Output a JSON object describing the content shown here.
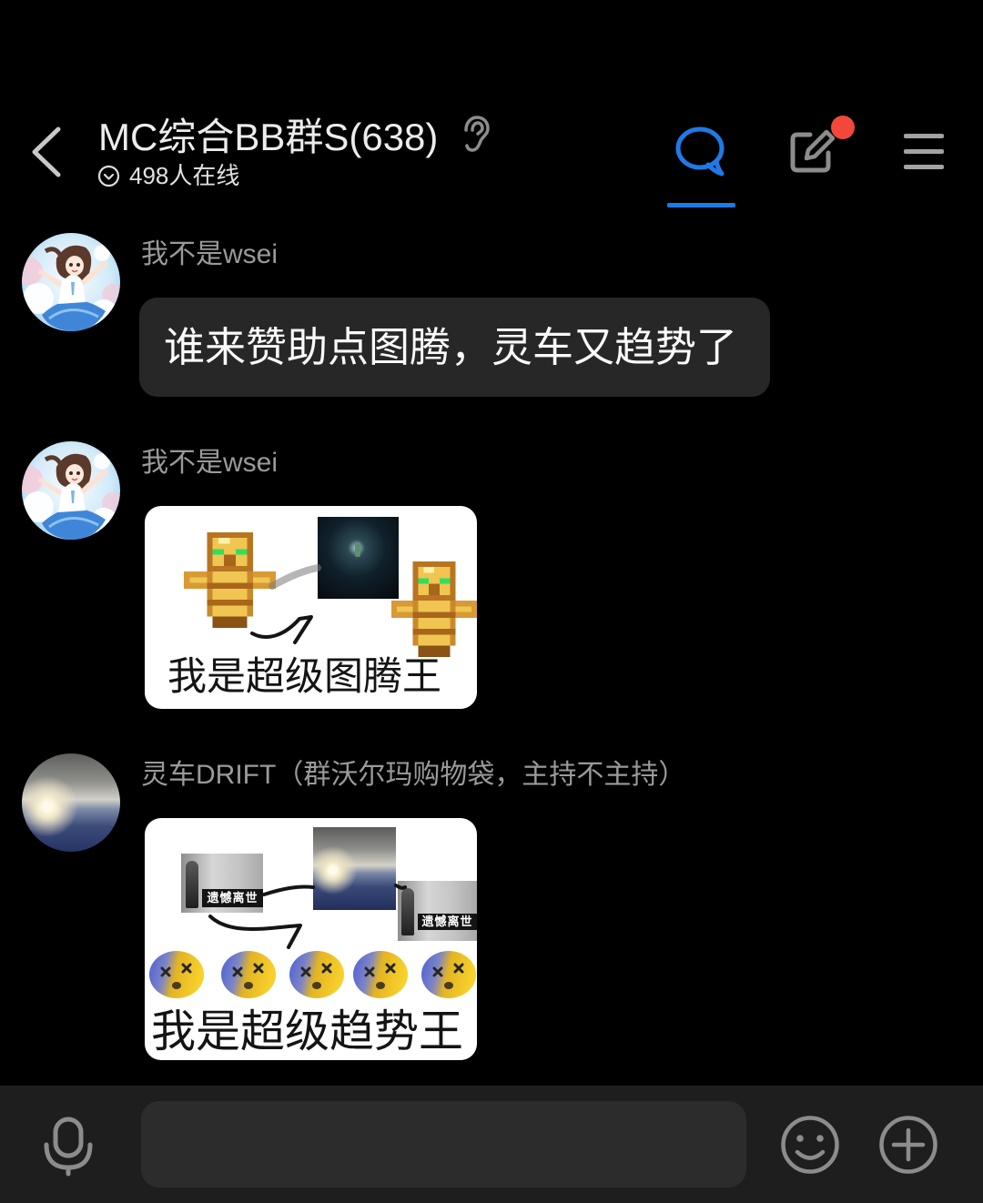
{
  "colors": {
    "background": "#000000",
    "accent": "#1f7ae6",
    "notification_dot": "#f2473a",
    "bubble": "#272727",
    "bottom_bar": "#1e1e1e",
    "icon_gray": "#8c8c8c"
  },
  "header": {
    "title": "MC综合BB群S(638)",
    "online_count_text": "498人在线",
    "chat_tab_active": true,
    "notes_has_notification": true,
    "icons": {
      "back": "chevron-left-icon",
      "earpiece": "ear-icon",
      "online_status": "circle-chevron-down-icon",
      "chat_tab": "chat-bubble-icon",
      "notes": "edit-icon",
      "menu": "menu-icon"
    }
  },
  "messages": [
    {
      "sender": "我不是wsei",
      "avatar_icon": "anime-girl-avatar",
      "text": "谁来赞助点图腾，灵车又趋势了"
    },
    {
      "sender": "我不是wsei",
      "avatar_icon": "anime-girl-avatar",
      "sticker": {
        "caption": "我是超级图腾王"
      }
    },
    {
      "sender": "灵车DRIFT（群沃尔玛购物袋，主持不主持）",
      "avatar_icon": "sunset-landscape-avatar",
      "sticker": {
        "caption": "我是超级趋势王",
        "overlay_labels": [
          "遗憾离世",
          "遗憾离世"
        ]
      }
    }
  ],
  "input_bar": {
    "value": "",
    "icons": {
      "voice": "microphone-icon",
      "emoji": "smiley-icon",
      "more": "plus-circle-icon"
    }
  }
}
